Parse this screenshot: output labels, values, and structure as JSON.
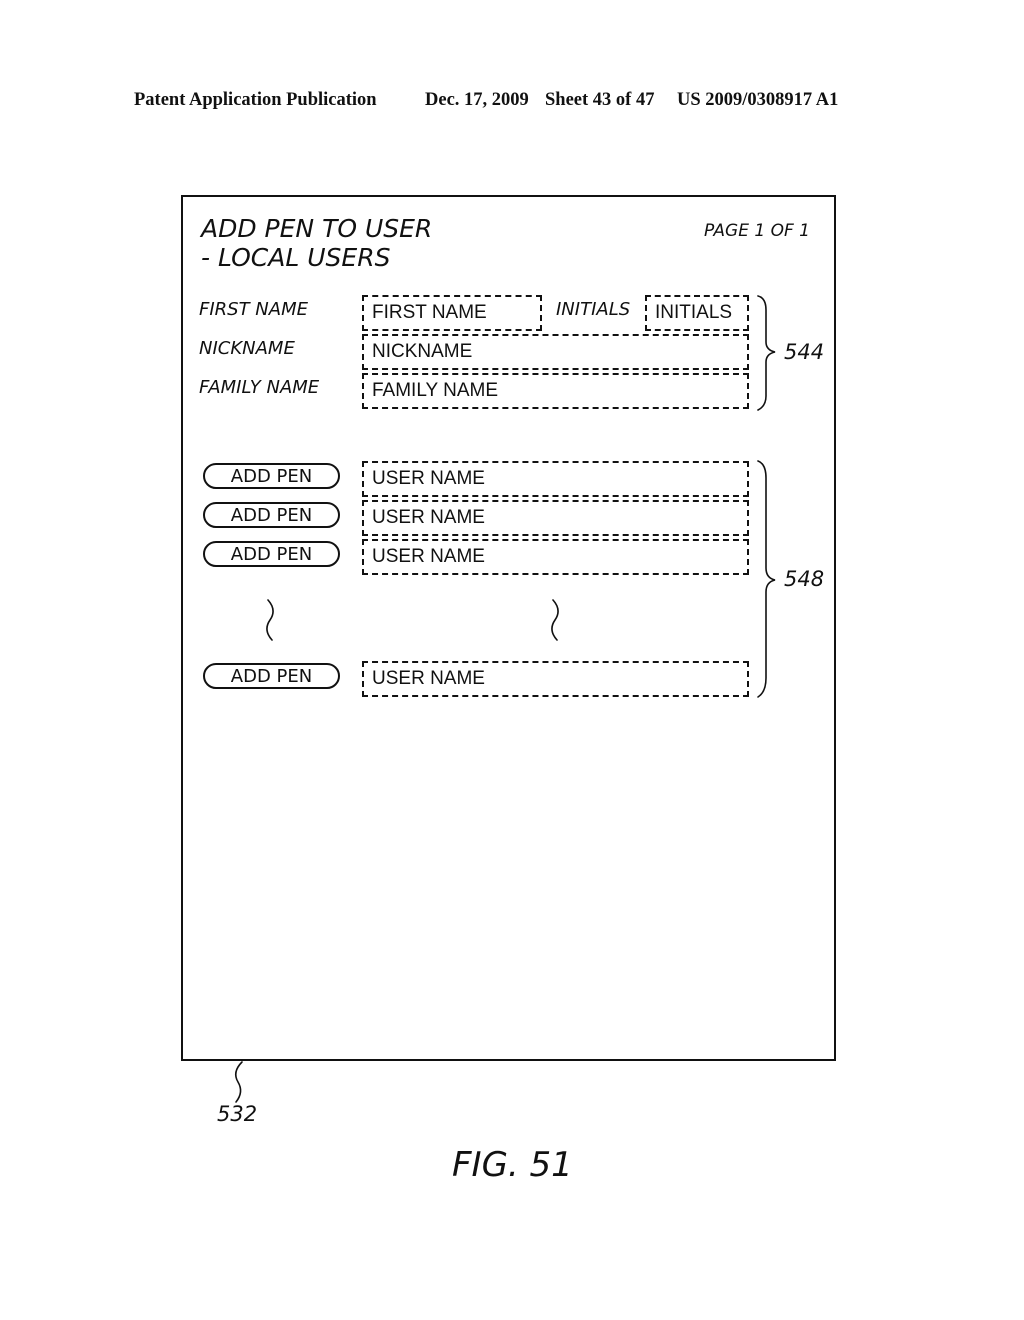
{
  "header": {
    "publication": "Patent Application Publication",
    "date": "Dec. 17, 2009",
    "sheet": "Sheet 43 of 47",
    "number": "US 2009/0308917 A1"
  },
  "screen": {
    "title_line1": "ADD PEN TO USER",
    "title_line2": "- LOCAL USERS",
    "page_indicator": "PAGE 1 OF 1",
    "ref": "532"
  },
  "form": {
    "first_name_label": "FIRST NAME",
    "first_name_placeholder": "FIRST NAME",
    "initials_label": "INITIALS",
    "initials_placeholder": "INITIALS",
    "nickname_label": "NICKNAME",
    "nickname_placeholder": "NICKNAME",
    "family_name_label": "FAMILY NAME",
    "family_name_placeholder": "FAMILY NAME",
    "ref": "544"
  },
  "user_list": {
    "rows": [
      {
        "button": "ADD PEN",
        "user": "USER NAME"
      },
      {
        "button": "ADD PEN",
        "user": "USER NAME"
      },
      {
        "button": "ADD PEN",
        "user": "USER NAME"
      },
      {
        "button": "ADD PEN",
        "user": "USER NAME"
      }
    ],
    "ref": "548"
  },
  "figure_label": "FIG. 51"
}
